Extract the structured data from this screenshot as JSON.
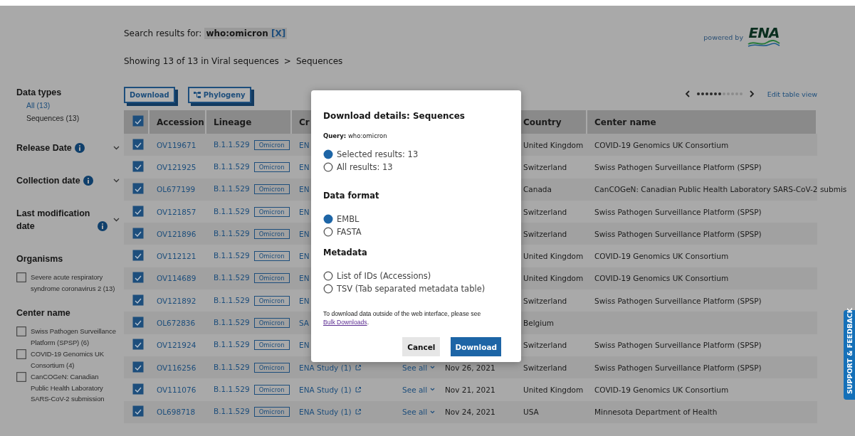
{
  "search": {
    "label": "Search results for:",
    "query": "who:omicron",
    "clear": "[X]"
  },
  "summary": {
    "showing": "Showing 13 of 13 in Viral sequences",
    "separator": ">",
    "current": "Sequences"
  },
  "logo": {
    "caption": "powered by",
    "text": "ENA"
  },
  "sidebar": {
    "data_types": {
      "title": "Data types",
      "items": [
        {
          "label": "All (13)",
          "selected": true
        },
        {
          "label": "Sequences (13)",
          "selected": false
        }
      ]
    },
    "date_filters": [
      {
        "title": "Release Date",
        "expanded": false
      },
      {
        "title": "Collection date",
        "expanded": false
      },
      {
        "title": "Last modification date",
        "expanded": false
      }
    ],
    "facets": [
      {
        "title": "Organisms",
        "items": [
          {
            "label": "Severe acute respiratory syndrome coronavirus 2 (13)",
            "checked": false
          }
        ]
      },
      {
        "title": "Center name",
        "items": [
          {
            "label": "Swiss Pathogen Surveillance Platform (SPSP) (6)",
            "checked": false
          },
          {
            "label": "COVID-19 Genomics UK Consortium (4)",
            "checked": false
          },
          {
            "label": "CanCOGeN: Canadian Public Health Laboratory SARS-CoV-2 submission",
            "checked": false
          }
        ]
      }
    ]
  },
  "toolbar": {
    "buttons": [
      "Download",
      "Phylogeny"
    ],
    "edit_link": "Edit table view",
    "pager_dots": [
      {
        "filled": true
      },
      {
        "filled": true
      },
      {
        "filled": true
      },
      {
        "filled": true
      },
      {
        "filled": true
      },
      {
        "filled": true
      },
      {
        "filled": false
      },
      {
        "filled": false
      },
      {
        "filled": false
      },
      {
        "filled": false
      },
      {
        "filled": false
      }
    ]
  },
  "table": {
    "all_checked": true,
    "columns": [
      "Accession",
      "Lineage",
      "Cr",
      "",
      "",
      "Country",
      "Center name"
    ],
    "rows": [
      {
        "checked": true,
        "accession": "OV119671",
        "lineage": "B.1.1.529",
        "tag": "Omicron",
        "column_3": "EN",
        "country": "United Kingdom",
        "center_name": "COVID-19 Genomics UK Consortium"
      },
      {
        "checked": true,
        "accession": "OV121925",
        "lineage": "B.1.1.529",
        "tag": "Omicron",
        "column_3": "EN",
        "country": "Switzerland",
        "center_name": "Swiss Pathogen Surveillance Platform (SPSP)"
      },
      {
        "checked": true,
        "accession": "OL677199",
        "lineage": "B.1.1.529",
        "tag": "Omicron",
        "column_3": "EN",
        "country": "Canada",
        "center_name": "CanCOGeN: Canadian Public Health Laboratory SARS-CoV-2 submis"
      },
      {
        "checked": true,
        "accession": "OV121857",
        "lineage": "B.1.1.529",
        "tag": "Omicron",
        "column_3": "EN",
        "country": "Switzerland",
        "center_name": "Swiss Pathogen Surveillance Platform (SPSP)"
      },
      {
        "checked": true,
        "accession": "OV121896",
        "lineage": "B.1.1.529",
        "tag": "Omicron",
        "column_3": "EN",
        "country": "Switzerland",
        "center_name": "Swiss Pathogen Surveillance Platform (SPSP)"
      },
      {
        "checked": true,
        "accession": "OV112121",
        "lineage": "B.1.1.529",
        "tag": "Omicron",
        "column_3": "EN",
        "country": "United Kingdom",
        "center_name": "COVID-19 Genomics UK Consortium"
      },
      {
        "checked": true,
        "accession": "OV114689",
        "lineage": "B.1.1.529",
        "tag": "Omicron",
        "column_3": "EN",
        "country": "United Kingdom",
        "center_name": "COVID-19 Genomics UK Consortium"
      },
      {
        "checked": true,
        "accession": "OV121892",
        "lineage": "B.1.1.529",
        "tag": "Omicron",
        "column_3": "EN",
        "country": "Switzerland",
        "center_name": "Swiss Pathogen Surveillance Platform (SPSP)"
      },
      {
        "checked": true,
        "accession": "OL672836",
        "lineage": "B.1.1.529",
        "tag": "Omicron",
        "column_3": "SA",
        "country": "Belgium"
      },
      {
        "checked": true,
        "accession": "OV121924",
        "lineage": "B.1.1.529",
        "tag": "Omicron",
        "column_3": "EN",
        "country": "Switzerland",
        "center_name": "Swiss Pathogen Surveillance Platform (SPSP)"
      },
      {
        "checked": true,
        "accession": "OV116256",
        "lineage": "B.1.1.529",
        "tag": "Omicron",
        "column_3": "ENA Study (1)",
        "see_all": "See all",
        "date": "Nov 26, 2021",
        "country": "Switzerland",
        "center_name": "Swiss Pathogen Surveillance Platform (SPSP)"
      },
      {
        "checked": true,
        "accession": "OV111076",
        "lineage": "B.1.1.529",
        "tag": "Omicron",
        "column_3": "ENA Study (1)",
        "see_all": "See all",
        "date": "Nov 21, 2021",
        "country": "United Kingdom",
        "center_name": "COVID-19 Genomics UK Consortium"
      },
      {
        "checked": true,
        "accession": "OL698718",
        "lineage": "B.1.1.529",
        "tag": "Omicron",
        "column_3": "ENA Study (1)",
        "see_all": "See all",
        "date": "Nov 24, 2021",
        "country": "USA",
        "center_name": "Minnesota Department of Health"
      }
    ]
  },
  "modal": {
    "title": "Download details: Sequences",
    "query_label": "Query:",
    "query": "who:omicron",
    "results": [
      {
        "label": "Selected results: 13",
        "selected": true
      },
      {
        "label": "All results: 13",
        "selected": false
      }
    ],
    "format_title": "Data format",
    "formats": [
      {
        "label": "EMBL",
        "selected": true
      },
      {
        "label": "FASTA",
        "selected": false
      }
    ],
    "metadata_title": "Metadata",
    "metadata": [
      {
        "label": "List of IDs (Accessions)",
        "selected": false
      },
      {
        "label": "TSV (Tab separated metadata table)",
        "selected": false
      }
    ],
    "note": "To download data outside of the web interface, please see",
    "note_link": "Bulk Downloads",
    "note_end": ".",
    "cancel": "Cancel",
    "download": "Download"
  },
  "feedback_tab": "SUPPORT & FEEDBACK"
}
